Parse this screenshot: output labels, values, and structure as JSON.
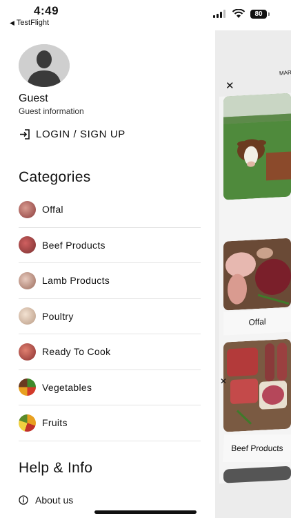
{
  "status_bar": {
    "time": "4:49",
    "back_app": "TestFlight",
    "battery": "80"
  },
  "drawer": {
    "user": {
      "name": "Guest",
      "subtitle": "Guest information"
    },
    "login_label": "LOGIN / SIGN UP",
    "categories_title": "Categories",
    "categories": [
      {
        "label": "Offal",
        "color": "#8a3b3b"
      },
      {
        "label": "Beef Products",
        "color": "#9c4a3d"
      },
      {
        "label": "Lamb Products",
        "color": "#b07a6a"
      },
      {
        "label": "Poultry",
        "color": "#d8b8a0"
      },
      {
        "label": "Ready To Cook",
        "color": "#a4413a"
      },
      {
        "label": "Vegetables",
        "color": "#4c8c2b"
      },
      {
        "label": "Fruits",
        "color": "#d98c2b"
      }
    ],
    "help_title": "Help & Info",
    "help_items": [
      {
        "label": "About us"
      }
    ]
  },
  "main_peek": {
    "header_fragment": "MAR",
    "cards": [
      {
        "label": "Offal"
      },
      {
        "label": "Beef Products"
      }
    ]
  },
  "colors": {
    "divider": "#e3e3e3",
    "text": "#111111",
    "peek_background": "#f4f4f4"
  }
}
